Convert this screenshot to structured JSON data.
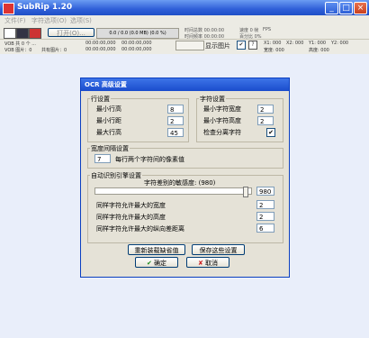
{
  "window": {
    "title": "SubRip 1.20"
  },
  "menu": {
    "items": [
      "文件(F)",
      "字符选项(O)",
      "选项(S)"
    ]
  },
  "toolbar": {
    "open_label": "打开(O)...",
    "range_label": "0.0 / 0.0 (0.0 MB) (0.0 %)",
    "info1": "时间总数 00:00:00",
    "info2": "速度 0 帧",
    "info3": "FPS",
    "info4": "时间频率 00:00:00",
    "info5": "百分比 0%"
  },
  "status": {
    "vob_label": "VOB 共 0 个 ...",
    "vob_label2": "VOB 图片：0",
    "count": "共有图片：0",
    "t1": "00:00:00,000",
    "t2": "00:00:00,000",
    "t3": "00:00:00,000",
    "t4": "00:00:00,000",
    "show_pics": "显示图片",
    "x1": "X1: 000",
    "x2": "X2: 000",
    "y1": "Y1: 000",
    "y2": "Y2: 000",
    "width": "宽度: 000",
    "height": "高度: 000"
  },
  "dialog": {
    "title": "OCR 高级设置",
    "line_group": {
      "legend": "行设置",
      "fields": [
        {
          "label": "最小行高",
          "value": "8"
        },
        {
          "label": "最小行距",
          "value": "2"
        },
        {
          "label": "最大行高",
          "value": "45"
        }
      ]
    },
    "char_group": {
      "legend": "字符设置",
      "fields": [
        {
          "label": "最小字符宽度",
          "value": "2"
        },
        {
          "label": "最小字符高度",
          "value": "2"
        }
      ],
      "check_label": "检查分离字符",
      "check_mark": "✔"
    },
    "space_group": {
      "legend": "宽度间隔设置",
      "value": "7",
      "label": "每行两个字符间的像素值"
    },
    "auto_group": {
      "legend": "自动识别引擎设置",
      "sensitivity_label": "字符差别的敏感度: (980)",
      "sensitivity_value": "980",
      "sensitivity_level": 0.98,
      "fields": [
        {
          "label": "同样字符允许最大的宽度",
          "value": "2"
        },
        {
          "label": "同样字符允许最大的高度",
          "value": "2"
        },
        {
          "label": "同样字符允许最大的纵向差距离",
          "value": "6"
        }
      ]
    },
    "buttons": {
      "reset": "重新装载缺省值",
      "save": "保存这些设置",
      "ok": "确定",
      "cancel": "取消",
      "ok_icon": "check-icon",
      "cancel_icon": "cross-icon"
    }
  }
}
